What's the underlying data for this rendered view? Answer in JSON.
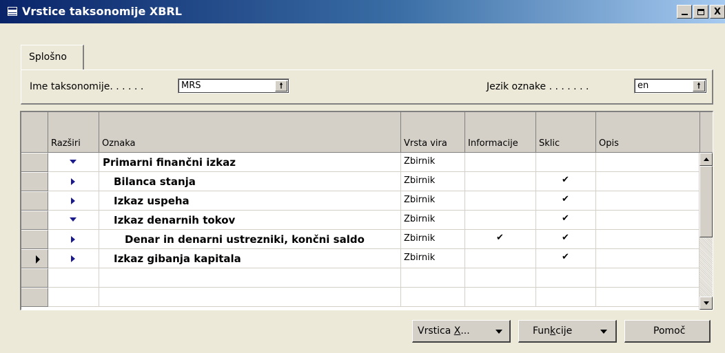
{
  "window": {
    "title": "Vrstice taksonomije XBRL",
    "minimize_label": "_",
    "maximize_label": "",
    "close_label": "X"
  },
  "tabs": [
    {
      "label": "Splošno",
      "active": true
    }
  ],
  "fields": {
    "taxonomy_name_label": "Ime taksonomije. . . . . .",
    "taxonomy_name_value": "MRS",
    "label_language_label": "Jezik oznake . . . . . . .",
    "label_language_value": "en"
  },
  "table": {
    "headers": [
      "Razširi",
      "Oznaka",
      "Vrsta vira",
      "Informacije",
      "Sklic",
      "Opis"
    ],
    "rows": [
      {
        "expand": "down",
        "indent": 0,
        "label": "Primarni finančni izkaz",
        "source_type": "Zbirnik",
        "info": "",
        "ref": "",
        "desc": "",
        "selected": false
      },
      {
        "expand": "right",
        "indent": 1,
        "label": "Bilanca stanja",
        "source_type": "Zbirnik",
        "info": "",
        "ref": "✔",
        "desc": "",
        "selected": false
      },
      {
        "expand": "right",
        "indent": 1,
        "label": "Izkaz uspeha",
        "source_type": "Zbirnik",
        "info": "",
        "ref": "✔",
        "desc": "",
        "selected": false
      },
      {
        "expand": "down",
        "indent": 1,
        "label": "Izkaz denarnih tokov",
        "source_type": "Zbirnik",
        "info": "",
        "ref": "✔",
        "desc": "",
        "selected": false
      },
      {
        "expand": "right",
        "indent": 2,
        "label": "Denar in denarni ustrezniki, končni saldo",
        "source_type": "Zbirnik",
        "info": "✔",
        "ref": "✔",
        "desc": "",
        "selected": false
      },
      {
        "expand": "right",
        "indent": 1,
        "label": "Izkaz gibanja kapitala",
        "source_type": "Zbirnik",
        "info": "",
        "ref": "✔",
        "desc": "",
        "selected": true
      }
    ]
  },
  "buttons": {
    "line_pre": "Vrstica ",
    "line_u": "X",
    "line_post": "...",
    "functions_pre": "Fun",
    "functions_u": "k",
    "functions_post": "cije",
    "help": "Pomoč"
  },
  "colors": {
    "titlebar_start": "#0a246a",
    "titlebar_end": "#a6caf0",
    "face": "#ece9d8",
    "arrow": "#1a1a8c"
  }
}
